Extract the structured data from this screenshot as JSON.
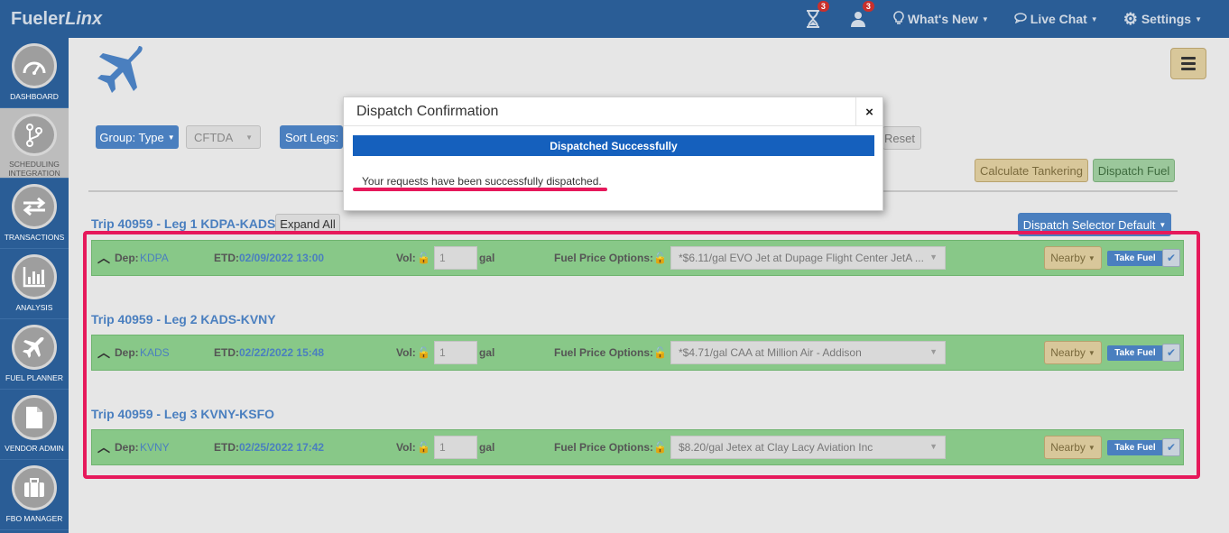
{
  "brand": {
    "part1": "Fueler",
    "part2": "Linx"
  },
  "topnav": {
    "hourglass_badge": "3",
    "user_badge": "3",
    "whats_new": "What's New",
    "live_chat": "Live Chat",
    "settings": "Settings"
  },
  "sidebar": {
    "items": [
      {
        "label": "DASHBOARD",
        "icon": "gauge-icon"
      },
      {
        "label": "SCHEDULING INTEGRATION",
        "icon": "branch-icon"
      },
      {
        "label": "TRANSACTIONS",
        "icon": "swap-arrows-icon"
      },
      {
        "label": "ANALYSIS",
        "icon": "bar-chart-icon"
      },
      {
        "label": "FUEL PLANNER",
        "icon": "plane-icon"
      },
      {
        "label": "VENDOR ADMIN",
        "icon": "document-icon"
      },
      {
        "label": "FBO MANAGER",
        "icon": "briefcase-icon"
      }
    ]
  },
  "toolbar": {
    "group_type": "Group: Type",
    "group_value": "CFTDA",
    "sort_legs": "Sort Legs:",
    "reset": "Reset",
    "calculate_tankering": "Calculate Tankering",
    "dispatch_fuel": "Dispatch Fuel",
    "expand_all": "Expand All",
    "dispatch_selector": "Dispatch Selector Default"
  },
  "legs": [
    {
      "title": "Trip 40959 - Leg 1 KDPA-KADS",
      "dep_label": "Dep:",
      "dep": "KDPA",
      "etd_label": "ETD:",
      "etd": "02/09/2022 13:00",
      "vol_label": "Vol:",
      "vol": "1",
      "unit": "gal",
      "fpo_label": "Fuel Price Options:",
      "price": "*$6.11/gal EVO Jet at Dupage Flight Center JetA ...",
      "nearby": "Nearby",
      "take_fuel": "Take Fuel"
    },
    {
      "title": "Trip 40959 - Leg 2 KADS-KVNY",
      "dep_label": "Dep:",
      "dep": "KADS",
      "etd_label": "ETD:",
      "etd": "02/22/2022 15:48",
      "vol_label": "Vol:",
      "vol": "1",
      "unit": "gal",
      "fpo_label": "Fuel Price Options:",
      "price": "*$4.71/gal CAA at Million Air - Addison",
      "nearby": "Nearby",
      "take_fuel": "Take Fuel"
    },
    {
      "title": "Trip 40959 - Leg 3 KVNY-KSFO",
      "dep_label": "Dep:",
      "dep": "KVNY",
      "etd_label": "ETD:",
      "etd": "02/25/2022 17:42",
      "vol_label": "Vol:",
      "vol": "1",
      "unit": "gal",
      "fpo_label": "Fuel Price Options:",
      "price": "$8.20/gal Jetex at Clay Lacy Aviation Inc",
      "nearby": "Nearby",
      "take_fuel": "Take Fuel"
    }
  ],
  "modal": {
    "title": "Dispatch Confirmation",
    "close": "×",
    "banner": "Dispatched Successfully",
    "message": "Your requests have been successfully dispatched."
  }
}
